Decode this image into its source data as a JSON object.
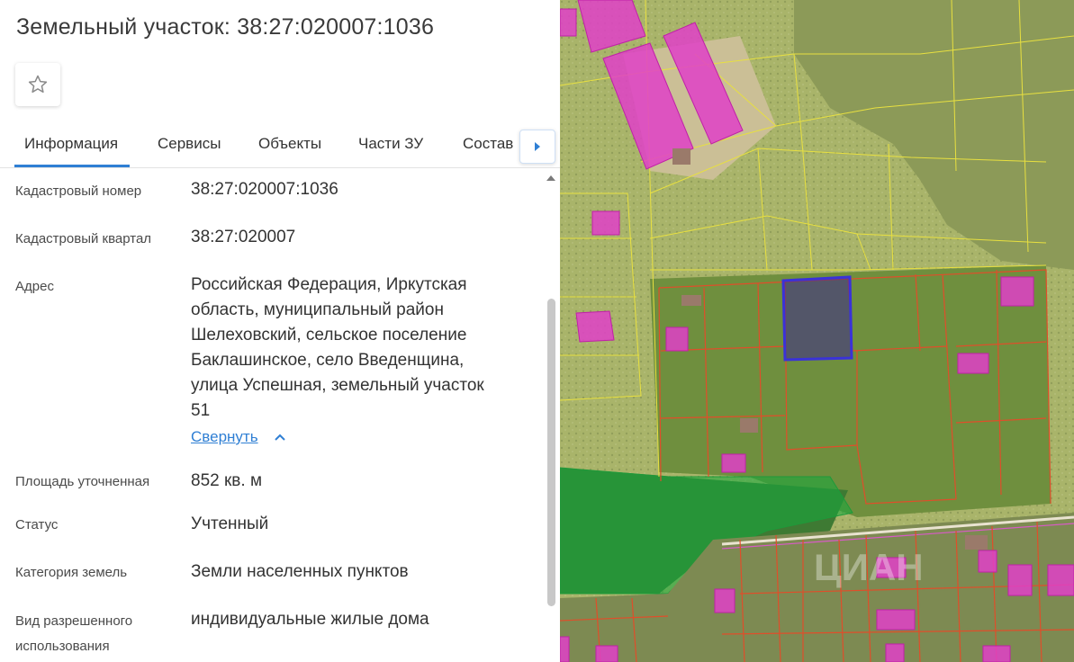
{
  "header": {
    "title": "Земельный участок: 38:27:020007:1036"
  },
  "favorite": {
    "icon": "star-outline-icon"
  },
  "tabs": [
    {
      "label": "Информация",
      "active": true
    },
    {
      "label": "Сервисы"
    },
    {
      "label": "Объекты"
    },
    {
      "label": "Части ЗУ"
    },
    {
      "label": "Состав"
    }
  ],
  "tabs_next_icon": "triangle-right-icon",
  "info": {
    "cadastral_number": {
      "label": "Кадастровый номер",
      "value": "38:27:020007:1036"
    },
    "cadastral_quarter": {
      "label": "Кадастровый квартал",
      "value": "38:27:020007"
    },
    "address": {
      "label": "Адрес",
      "lines": [
        "Российская Федерация, Иркутская",
        "область, муниципальный район",
        "Шелеховский, сельское поселение",
        "Баклашинское, село Введенщина,",
        "улица Успешная, земельный участок",
        "51"
      ],
      "collapse_label": "Свернуть"
    },
    "area": {
      "label": "Площадь уточненная",
      "value": "852 кв. м"
    },
    "status": {
      "label": "Статус",
      "value": "Учтенный"
    },
    "land_category": {
      "label": "Категория земель",
      "value": "Земли населенных пунктов"
    },
    "permitted_use": {
      "label_lines": [
        "Вид разрешенного",
        "использования"
      ],
      "value": "индивидуальные жилые дома"
    }
  },
  "map": {
    "watermark": "ЦИАН",
    "colors": {
      "parcel_selected": "#3a32d8",
      "building": "#e040c8",
      "parcel_border": "#e04e2a",
      "zone_border": "#e8e040",
      "forest_zone": "#1e9a3a"
    }
  }
}
